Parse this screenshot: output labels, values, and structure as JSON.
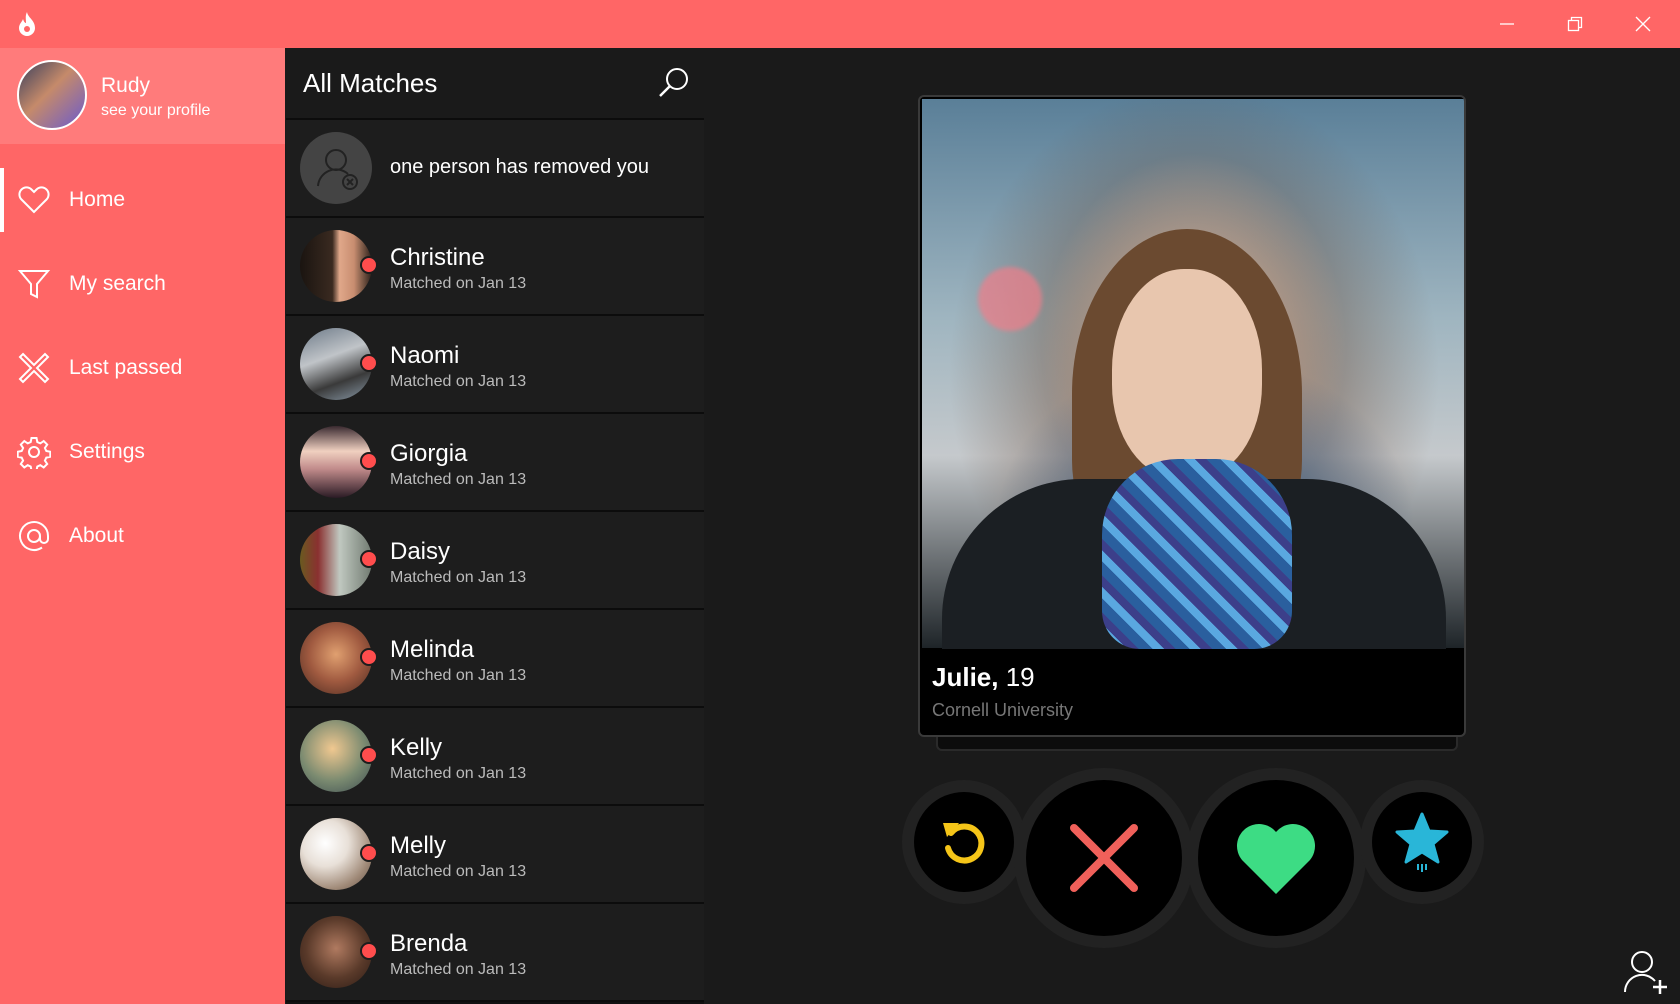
{
  "window": {
    "app_icon": "flame-icon",
    "controls": [
      "minimize-icon",
      "restore-icon",
      "close-icon"
    ]
  },
  "profile": {
    "name": "Rudy",
    "subtitle": "see your profile"
  },
  "nav": {
    "items": [
      {
        "label": "Home",
        "icon": "heart-icon",
        "active": true
      },
      {
        "label": "My search",
        "icon": "filter-icon",
        "active": false
      },
      {
        "label": "Last passed",
        "icon": "cross-icon",
        "active": false
      },
      {
        "label": "Settings",
        "icon": "gear-icon",
        "active": false
      },
      {
        "label": "About",
        "icon": "at-icon",
        "active": false
      }
    ]
  },
  "matches": {
    "title": "All Matches",
    "removed_notice": "one person has removed you",
    "items": [
      {
        "name": "Christine",
        "sub": "Matched on Jan 13"
      },
      {
        "name": "Naomi",
        "sub": "Matched on Jan 13"
      },
      {
        "name": "Giorgia",
        "sub": "Matched on Jan 13"
      },
      {
        "name": "Daisy",
        "sub": "Matched on Jan 13"
      },
      {
        "name": "Melinda",
        "sub": "Matched on Jan 13"
      },
      {
        "name": "Kelly",
        "sub": "Matched on Jan 13"
      },
      {
        "name": "Melly",
        "sub": "Matched on Jan 13"
      },
      {
        "name": "Brenda",
        "sub": "Matched on Jan 13"
      }
    ]
  },
  "card": {
    "name": "Julie,",
    "age": "19",
    "school": "Cornell University"
  },
  "colors": {
    "accent": "#ff6666",
    "undo": "#f5c518",
    "pass": "#f0605a",
    "like": "#3ddc84",
    "superlike": "#29b6d8"
  }
}
